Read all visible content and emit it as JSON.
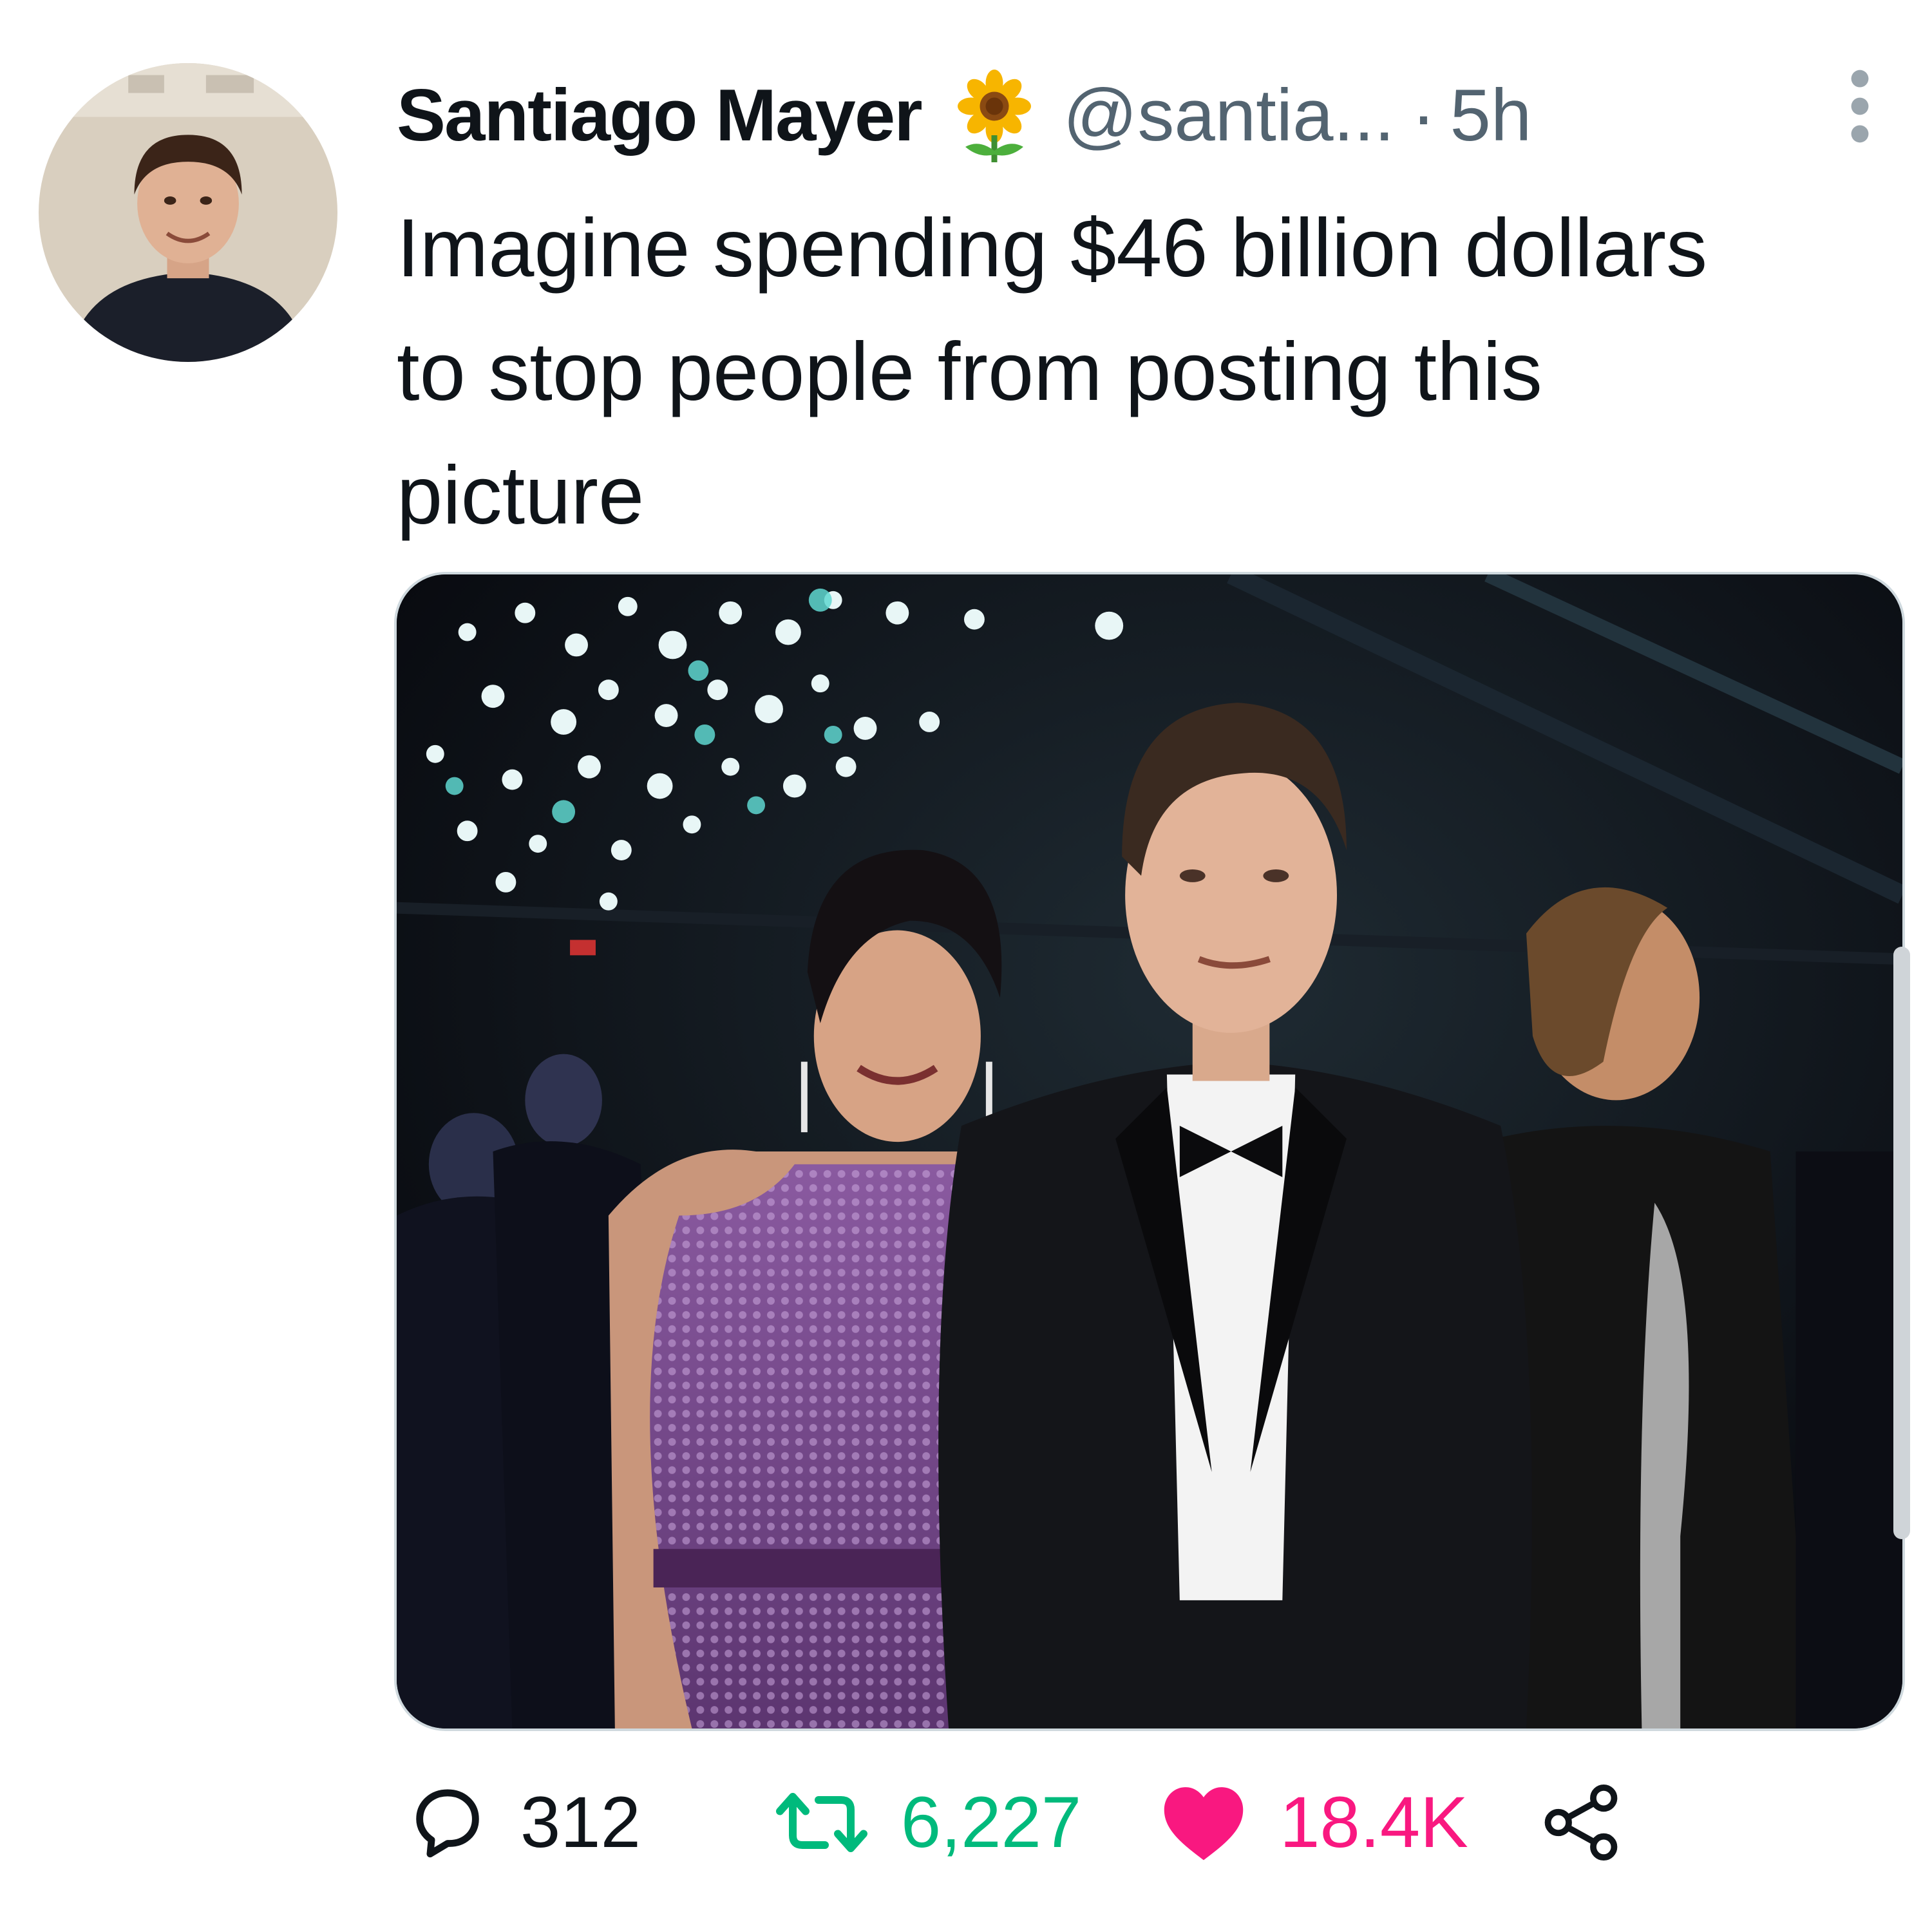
{
  "tweet": {
    "author": {
      "display_name": "Santiago Mayer",
      "emoji_icon": "sunflower-icon",
      "handle": "@santia...",
      "separator": "·",
      "time": "5h"
    },
    "text_lines": [
      "Imagine spending $46 billion dollars",
      "to stop people from posting this",
      "picture"
    ],
    "media": {
      "type": "photo",
      "alt": "Photo of a woman in a purple sequined dress and a man in a tuxedo with a bow tie at a party"
    },
    "actions": {
      "reply": {
        "icon": "reply-icon",
        "count": "312"
      },
      "retweet": {
        "icon": "retweet-icon",
        "count": "6,227"
      },
      "like": {
        "icon": "heart-icon",
        "count": "18.4K"
      },
      "share": {
        "icon": "share-icon"
      }
    },
    "colors": {
      "text": "#0f1419",
      "secondary": "#536471",
      "retweet": "#00ba7c",
      "like": "#f91880"
    }
  }
}
